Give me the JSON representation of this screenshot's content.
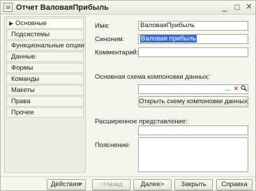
{
  "window": {
    "title": "Отчет ВаловаяПрибыль",
    "minimize_glyph": "_",
    "maximize_glyph": "□",
    "close_glyph": "✕"
  },
  "nav": {
    "items": [
      {
        "label": "Основные",
        "active": true
      },
      {
        "label": "Подсистемы"
      },
      {
        "label": "Функциональные опции"
      },
      {
        "label": "Данные"
      },
      {
        "label": "Формы"
      },
      {
        "label": "Команды"
      },
      {
        "label": "Макеты"
      },
      {
        "label": "Права"
      },
      {
        "label": "Прочее"
      }
    ],
    "active_arrow": "▶"
  },
  "form": {
    "name_label": "Имя:",
    "name_value": "ВаловаяПрибыль",
    "synonym_label": "Синоним:",
    "synonym_value": "Валовая прибыль",
    "comment_label": "Комментарий:",
    "comment_value": "",
    "schema_label": "Основная схема компоновки данных:",
    "schema_value": "",
    "schema_choose_glyph": "...",
    "schema_clear_glyph": "✕",
    "schema_open_glyph": "🔍",
    "open_schema_button": "Открыть схему компоновки данных",
    "extended_label": "Расширенное представление:",
    "extended_value": "",
    "explanation_label": "Пояснение:",
    "explanation_value": ""
  },
  "footer": {
    "actions": "Действия",
    "actions_arrow": "▾",
    "back": "<Назад",
    "next": "Далее>",
    "close": "Закрыть",
    "help": "Справка"
  },
  "colors": {
    "window_bg": "#f5f5ee",
    "selection": "#3a6bd6"
  }
}
